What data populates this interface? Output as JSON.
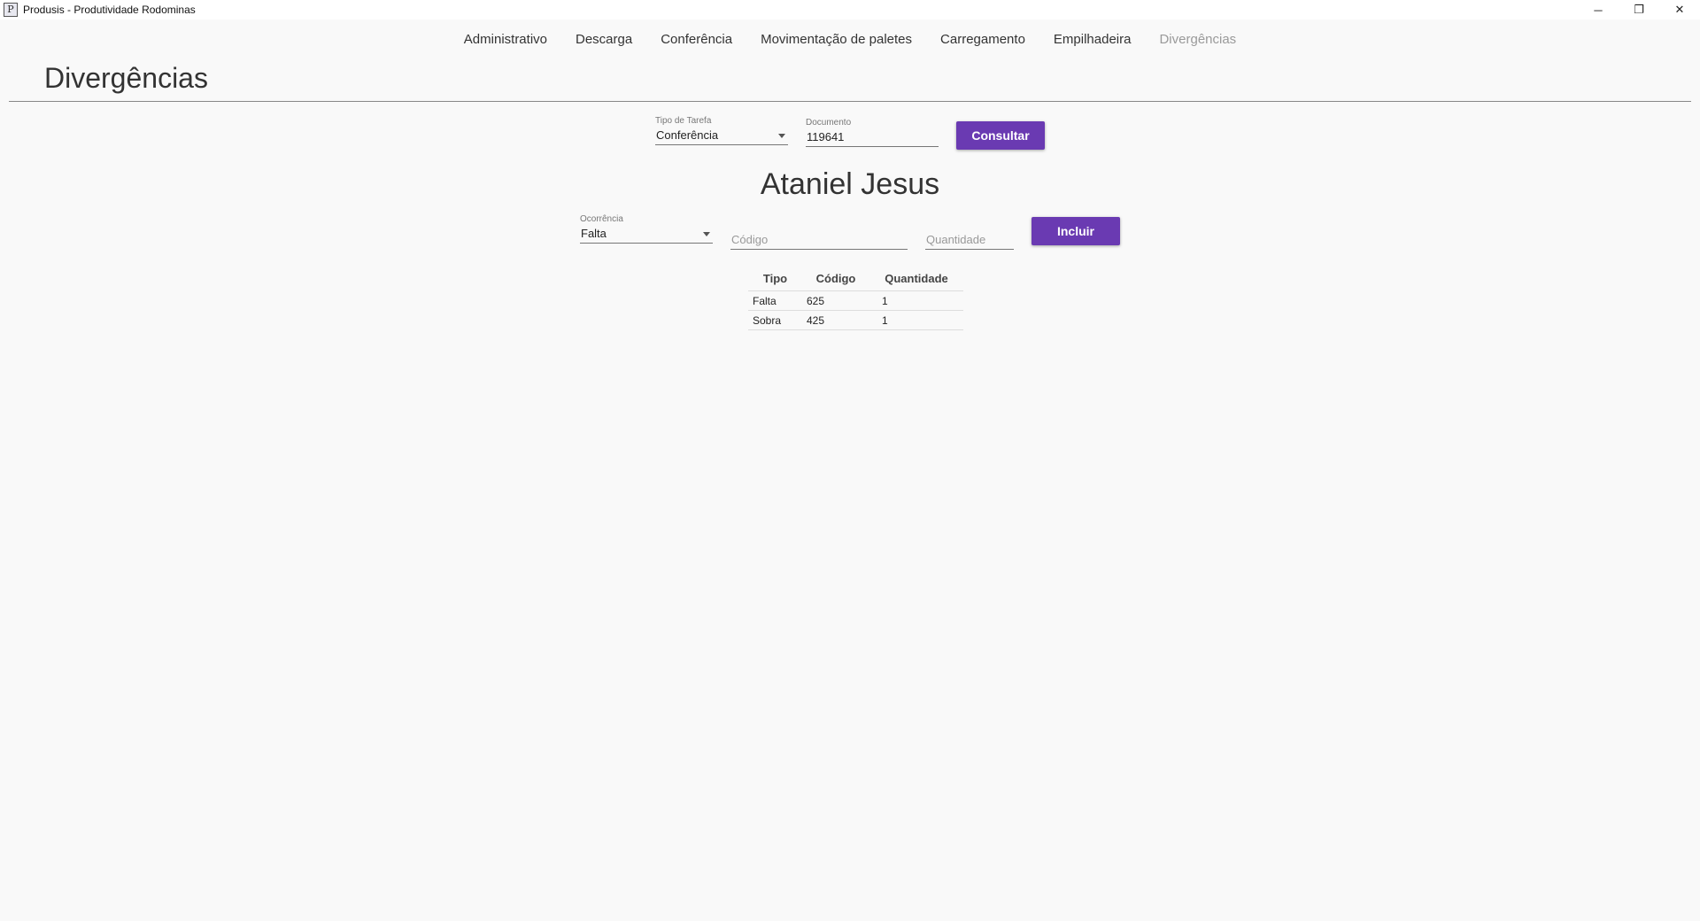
{
  "window": {
    "icon_letter": "P",
    "title": "Produsis - Produtividade Rodominas",
    "controls": [
      "─",
      "❐",
      "✕"
    ]
  },
  "nav": [
    {
      "label": "Administrativo",
      "active": false
    },
    {
      "label": "Descarga",
      "active": false
    },
    {
      "label": "Conferência",
      "active": false
    },
    {
      "label": "Movimentação de paletes",
      "active": false
    },
    {
      "label": "Carregamento",
      "active": false
    },
    {
      "label": "Empilhadeira",
      "active": false
    },
    {
      "label": "Divergências",
      "active": true
    }
  ],
  "page_title": "Divergências",
  "query": {
    "task_type_label": "Tipo de Tarefa",
    "task_type_value": "Conferência",
    "document_label": "Documento",
    "document_value": "119641",
    "submit_label": "Consultar"
  },
  "person_name": "Ataniel Jesus",
  "entry": {
    "occurrence_label": "Ocorrência",
    "occurrence_value": "Falta",
    "code_placeholder": "Código",
    "quantity_placeholder": "Quantidade",
    "submit_label": "Incluir"
  },
  "table": {
    "headers": [
      "Tipo",
      "Código",
      "Quantidade"
    ],
    "rows": [
      [
        "Falta",
        "625",
        "1"
      ],
      [
        "Sobra",
        "425",
        "1"
      ]
    ]
  },
  "colors": {
    "accent": "#6a3ab2",
    "background": "#f9f9f9",
    "nav_active": "#9a9a9a"
  }
}
